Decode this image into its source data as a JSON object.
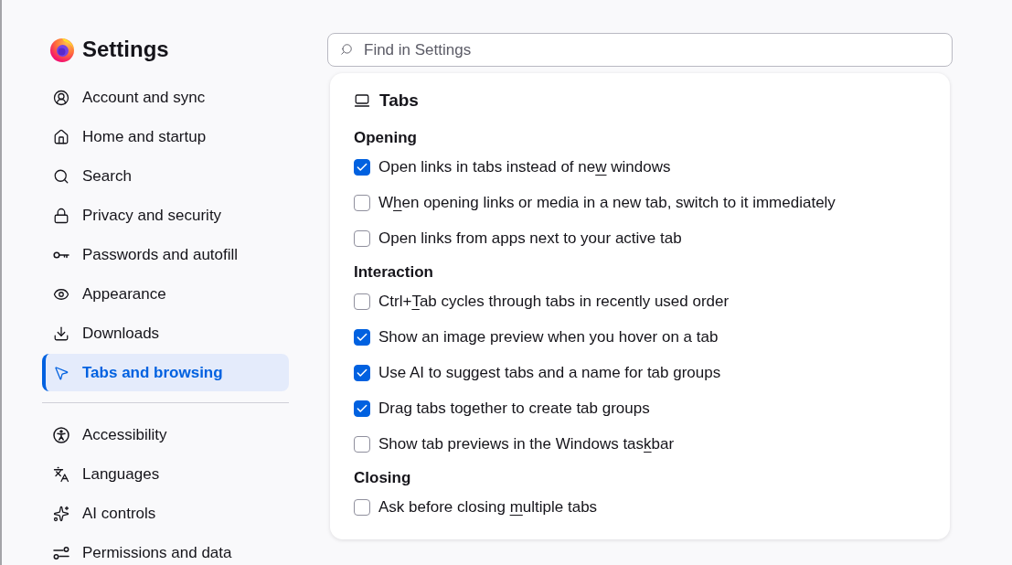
{
  "sidebar": {
    "title": "Settings",
    "groups": [
      {
        "items": [
          {
            "label": "Account and sync",
            "selected": false
          },
          {
            "label": "Home and startup",
            "selected": false
          },
          {
            "label": "Search",
            "selected": false
          },
          {
            "label": "Privacy and security",
            "selected": false
          },
          {
            "label": "Passwords and autofill",
            "selected": false
          },
          {
            "label": "Appearance",
            "selected": false
          },
          {
            "label": "Downloads",
            "selected": false
          },
          {
            "label": "Tabs and browsing",
            "selected": true
          }
        ]
      },
      {
        "items": [
          {
            "label": "Accessibility",
            "selected": false
          },
          {
            "label": "Languages",
            "selected": false
          },
          {
            "label": "AI controls",
            "selected": false
          },
          {
            "label": "Permissions and data",
            "selected": false
          }
        ]
      }
    ]
  },
  "search": {
    "placeholder": "Find in Settings"
  },
  "card": {
    "title": "Tabs",
    "sections": [
      {
        "heading": "Opening",
        "options": [
          {
            "label": [
              {
                "text": "Open links in tabs instead of ne",
                "access_key": false
              },
              {
                "text": "w",
                "access_key": true
              },
              {
                "text": " windows",
                "access_key": false
              }
            ],
            "checked": true
          },
          {
            "label": [
              {
                "text": "W",
                "access_key": false
              },
              {
                "text": "h",
                "access_key": true
              },
              {
                "text": "en opening links or media in a new tab, switch to it immediately",
                "access_key": false
              }
            ],
            "checked": false
          },
          {
            "label": [
              {
                "text": "Open links from apps next to your active tab",
                "access_key": false
              }
            ],
            "checked": false
          }
        ]
      },
      {
        "heading": "Interaction",
        "options": [
          {
            "label": [
              {
                "text": "Ctrl+",
                "access_key": false
              },
              {
                "text": "T",
                "access_key": true
              },
              {
                "text": "ab cycles through tabs in recently used order",
                "access_key": false
              }
            ],
            "checked": false
          },
          {
            "label": [
              {
                "text": "Show an image preview when you hover on a tab",
                "access_key": false
              }
            ],
            "checked": true
          },
          {
            "label": [
              {
                "text": "Use AI to suggest tabs and a name for tab groups",
                "access_key": false
              }
            ],
            "checked": true
          },
          {
            "label": [
              {
                "text": "Drag tabs together to create tab groups",
                "access_key": false
              }
            ],
            "checked": true
          },
          {
            "label": [
              {
                "text": "Show tab previews in the Windows tas",
                "access_key": false
              },
              {
                "text": "k",
                "access_key": true
              },
              {
                "text": "bar",
                "access_key": false
              }
            ],
            "checked": false
          }
        ]
      },
      {
        "heading": "Closing",
        "options": [
          {
            "label": [
              {
                "text": "Ask before closing ",
                "access_key": false
              },
              {
                "text": "m",
                "access_key": true
              },
              {
                "text": "ultiple tabs",
                "access_key": false
              }
            ],
            "checked": false
          }
        ]
      }
    ]
  }
}
